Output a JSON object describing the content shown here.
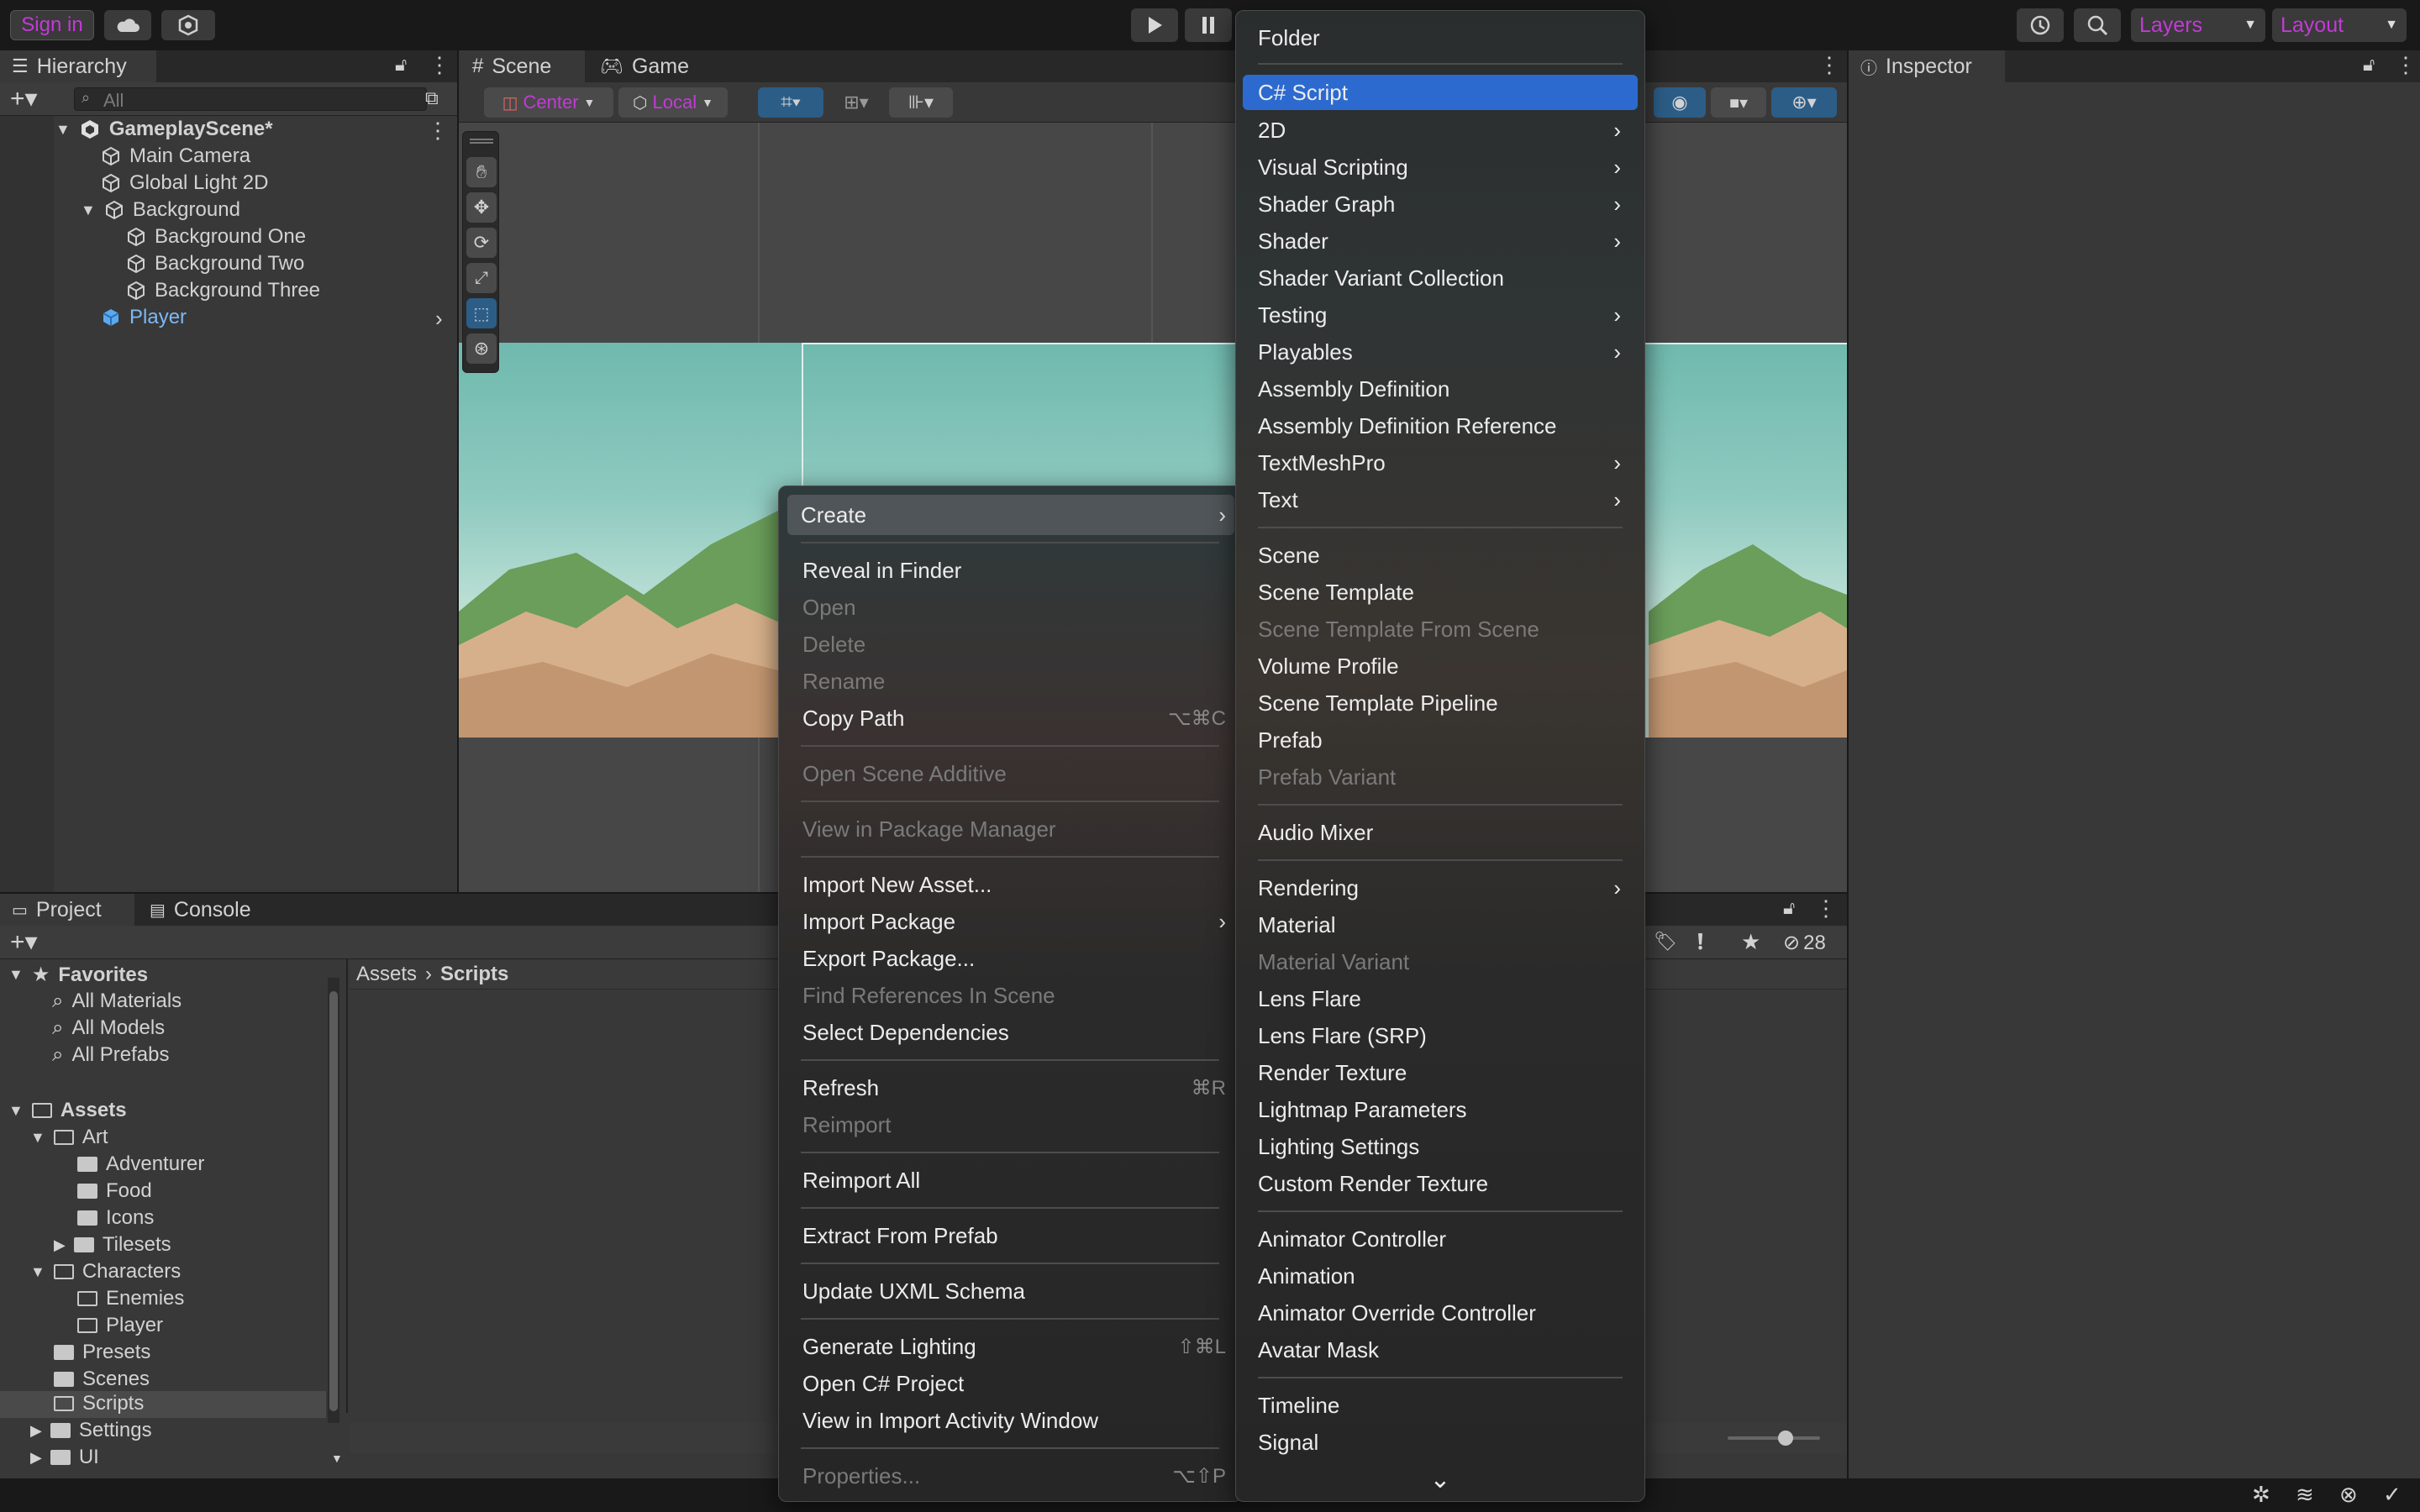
{
  "toolbar": {
    "sign_in": "Sign in",
    "layers": "Layers",
    "layout": "Layout"
  },
  "hierarchy": {
    "title": "Hierarchy",
    "search_placeholder": "All",
    "scene": "GameplayScene*",
    "items": [
      {
        "label": "Main Camera"
      },
      {
        "label": "Global Light 2D"
      },
      {
        "label": "Background"
      },
      {
        "label": "Background One"
      },
      {
        "label": "Background Two"
      },
      {
        "label": "Background Three"
      },
      {
        "label": "Player"
      }
    ]
  },
  "scene_view": {
    "tabs": [
      {
        "label": "Scene"
      },
      {
        "label": "Game"
      }
    ],
    "pivot": "Center",
    "space": "Local"
  },
  "inspector": {
    "title": "Inspector"
  },
  "project": {
    "tabs": [
      {
        "label": "Project"
      },
      {
        "label": "Console"
      }
    ],
    "favorites": "Favorites",
    "fav_items": [
      {
        "label": "All Materials"
      },
      {
        "label": "All Models"
      },
      {
        "label": "All Prefabs"
      }
    ],
    "assets": "Assets",
    "tree": [
      {
        "label": "Art"
      },
      {
        "label": "Adventurer"
      },
      {
        "label": "Food"
      },
      {
        "label": "Icons"
      },
      {
        "label": "Tilesets"
      },
      {
        "label": "Characters"
      },
      {
        "label": "Enemies"
      },
      {
        "label": "Player"
      },
      {
        "label": "Presets"
      },
      {
        "label": "Scenes"
      },
      {
        "label": "Scripts"
      },
      {
        "label": "Settings"
      },
      {
        "label": "UI"
      }
    ],
    "breadcrumb": [
      "Assets",
      "Scripts"
    ],
    "hidden_count": "28"
  },
  "context_menu": {
    "items": [
      {
        "label": "Create",
        "arrow": "›"
      },
      {
        "label": "Reveal in Finder"
      },
      {
        "label": "Open"
      },
      {
        "label": "Delete"
      },
      {
        "label": "Rename"
      },
      {
        "label": "Copy Path",
        "shortcut": "⌥⌘C"
      },
      {
        "label": "Open Scene Additive"
      },
      {
        "label": "View in Package Manager"
      },
      {
        "label": "Import New Asset..."
      },
      {
        "label": "Import Package",
        "arrow": "›"
      },
      {
        "label": "Export Package..."
      },
      {
        "label": "Find References In Scene"
      },
      {
        "label": "Select Dependencies"
      },
      {
        "label": "Refresh",
        "shortcut": "⌘R"
      },
      {
        "label": "Reimport"
      },
      {
        "label": "Reimport All"
      },
      {
        "label": "Extract From Prefab"
      },
      {
        "label": "Update UXML Schema"
      },
      {
        "label": "Generate Lighting",
        "shortcut": "⇧⌘L"
      },
      {
        "label": "Open C# Project"
      },
      {
        "label": "View in Import Activity Window"
      },
      {
        "label": "Properties...",
        "shortcut": "⌥⇧P"
      }
    ]
  },
  "create_menu": {
    "items": [
      {
        "label": "Folder"
      },
      {
        "label": "C# Script"
      },
      {
        "label": "2D",
        "arrow": "›"
      },
      {
        "label": "Visual Scripting",
        "arrow": "›"
      },
      {
        "label": "Shader Graph",
        "arrow": "›"
      },
      {
        "label": "Shader",
        "arrow": "›"
      },
      {
        "label": "Shader Variant Collection"
      },
      {
        "label": "Testing",
        "arrow": "›"
      },
      {
        "label": "Playables",
        "arrow": "›"
      },
      {
        "label": "Assembly Definition"
      },
      {
        "label": "Assembly Definition Reference"
      },
      {
        "label": "TextMeshPro",
        "arrow": "›"
      },
      {
        "label": "Text",
        "arrow": "›"
      },
      {
        "label": "Scene"
      },
      {
        "label": "Scene Template"
      },
      {
        "label": "Scene Template From Scene"
      },
      {
        "label": "Volume Profile"
      },
      {
        "label": "Scene Template Pipeline"
      },
      {
        "label": "Prefab"
      },
      {
        "label": "Prefab Variant"
      },
      {
        "label": "Audio Mixer"
      },
      {
        "label": "Rendering",
        "arrow": "›"
      },
      {
        "label": "Material"
      },
      {
        "label": "Material Variant"
      },
      {
        "label": "Lens Flare"
      },
      {
        "label": "Lens Flare (SRP)"
      },
      {
        "label": "Render Texture"
      },
      {
        "label": "Lightmap Parameters"
      },
      {
        "label": "Lighting Settings"
      },
      {
        "label": "Custom Render Texture"
      },
      {
        "label": "Animator Controller"
      },
      {
        "label": "Animation"
      },
      {
        "label": "Animator Override Controller"
      },
      {
        "label": "Avatar Mask"
      },
      {
        "label": "Timeline"
      },
      {
        "label": "Signal"
      }
    ],
    "more": "⌄"
  },
  "colors": {
    "accent": "#2c6ad0",
    "brand_purple": "#c23bd6",
    "panel": "#383838",
    "selection": "#2c5d87"
  }
}
